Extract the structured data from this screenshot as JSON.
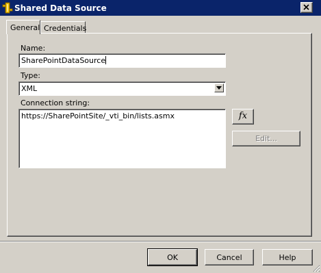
{
  "window": {
    "title": "Shared Data Source",
    "close_glyph": "✕"
  },
  "tabs": [
    {
      "label": "General",
      "active": true
    },
    {
      "label": "Credentials",
      "active": false
    }
  ],
  "general": {
    "name_label": "Name:",
    "name_value": "SharePointDataSource",
    "type_label": "Type:",
    "type_value": "XML",
    "connection_label": "Connection string:",
    "connection_value": "https://SharePointSite/_vti_bin/lists.asmx",
    "fx_label": "fx",
    "edit_label": "Edit..."
  },
  "buttons": {
    "ok": "OK",
    "cancel": "Cancel",
    "help": "Help"
  },
  "colors": {
    "titlebar": "#0a246a",
    "face": "#d4d0c8",
    "field": "#ffffff"
  }
}
